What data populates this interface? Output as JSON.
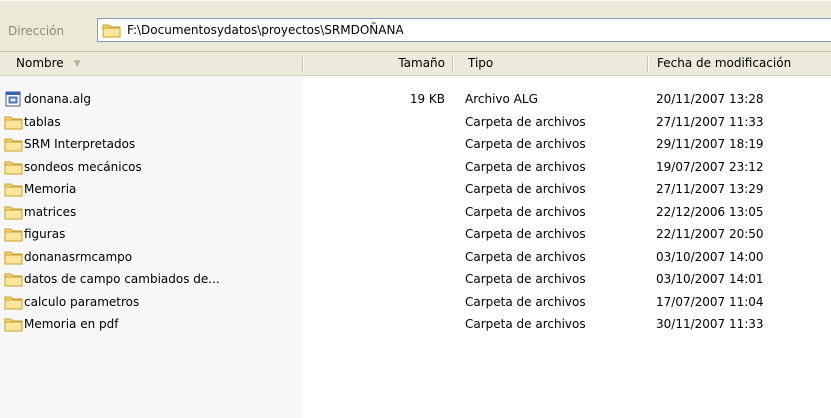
{
  "address": {
    "label": "Dirección",
    "path": "F:\\Documentosydatos\\proyectos\\SRMDOÑANA"
  },
  "columns": {
    "name": "Nombre",
    "size": "Tamaño",
    "type": "Tipo",
    "date": "Fecha de modificación"
  },
  "files": [
    {
      "icon": "alg-file-icon",
      "name": "donana.alg",
      "size": "19 KB",
      "type": "Archivo ALG",
      "date": "20/11/2007 13:28"
    },
    {
      "icon": "folder-icon",
      "name": "tablas",
      "size": "",
      "type": "Carpeta de archivos",
      "date": "27/11/2007 11:33"
    },
    {
      "icon": "folder-icon",
      "name": "SRM Interpretados",
      "size": "",
      "type": "Carpeta de archivos",
      "date": "29/11/2007 18:19"
    },
    {
      "icon": "folder-icon",
      "name": "sondeos mecánicos",
      "size": "",
      "type": "Carpeta de archivos",
      "date": "19/07/2007 23:12"
    },
    {
      "icon": "folder-icon",
      "name": "Memoria",
      "size": "",
      "type": "Carpeta de archivos",
      "date": "27/11/2007 13:29"
    },
    {
      "icon": "folder-icon",
      "name": "matrices",
      "size": "",
      "type": "Carpeta de archivos",
      "date": "22/12/2006 13:05"
    },
    {
      "icon": "folder-icon",
      "name": "figuras",
      "size": "",
      "type": "Carpeta de archivos",
      "date": "22/11/2007 20:50"
    },
    {
      "icon": "folder-icon",
      "name": "donanasrmcampo",
      "size": "",
      "type": "Carpeta de archivos",
      "date": "03/10/2007 14:00"
    },
    {
      "icon": "folder-icon",
      "name": "datos de campo cambiados de...",
      "size": "",
      "type": "Carpeta de archivos",
      "date": "03/10/2007 14:01"
    },
    {
      "icon": "folder-icon",
      "name": "calculo parametros",
      "size": "",
      "type": "Carpeta de archivos",
      "date": "17/07/2007 11:04"
    },
    {
      "icon": "folder-icon",
      "name": "Memoria en pdf",
      "size": "",
      "type": "Carpeta de archivos",
      "date": "30/11/2007 11:33"
    }
  ]
}
